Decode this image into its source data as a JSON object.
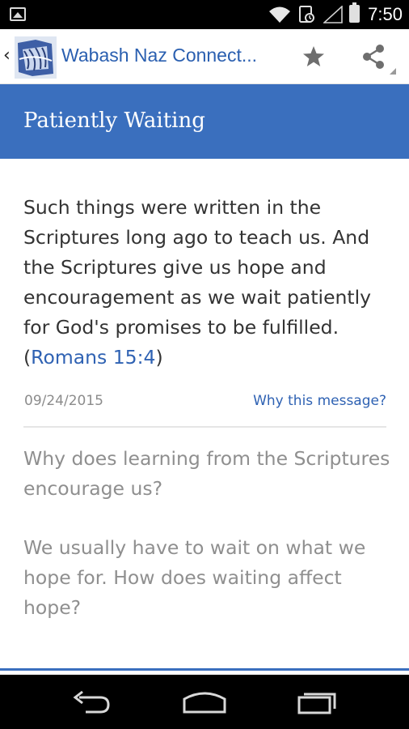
{
  "status_bar": {
    "time": "7:50",
    "icons": [
      "notification-image-icon",
      "wifi-icon",
      "sync-icon",
      "signal-icon",
      "battery-icon"
    ]
  },
  "action_bar": {
    "title": "Wabash Naz Connect...",
    "title_color": "#2a5fb0",
    "actions": [
      "star-icon",
      "share-icon"
    ]
  },
  "banner": {
    "title": "Patiently Waiting",
    "background": "#3a6fbe"
  },
  "message": {
    "verse_text": "Such things were written in the Scriptures long ago to teach us. And the Scriptures give us hope and encouragement as we wait patiently for God's promises to be fulfilled. ",
    "ref_open": "(",
    "reference": "Romans 15:4",
    "ref_close": ")",
    "date": "09/24/2015",
    "why_link": "Why this message?",
    "questions": [
      "Why does learning from the Scriptures encourage us?",
      "We usually have to wait on what we hope for. How does waiting affect hope?"
    ]
  },
  "nav_bar": {
    "buttons": [
      "back-icon",
      "home-icon",
      "recents-icon"
    ]
  },
  "colors": {
    "accent": "#3a6fbe",
    "link": "#2f62b3",
    "body_text": "#333333",
    "muted_text": "#8f8f8f"
  }
}
